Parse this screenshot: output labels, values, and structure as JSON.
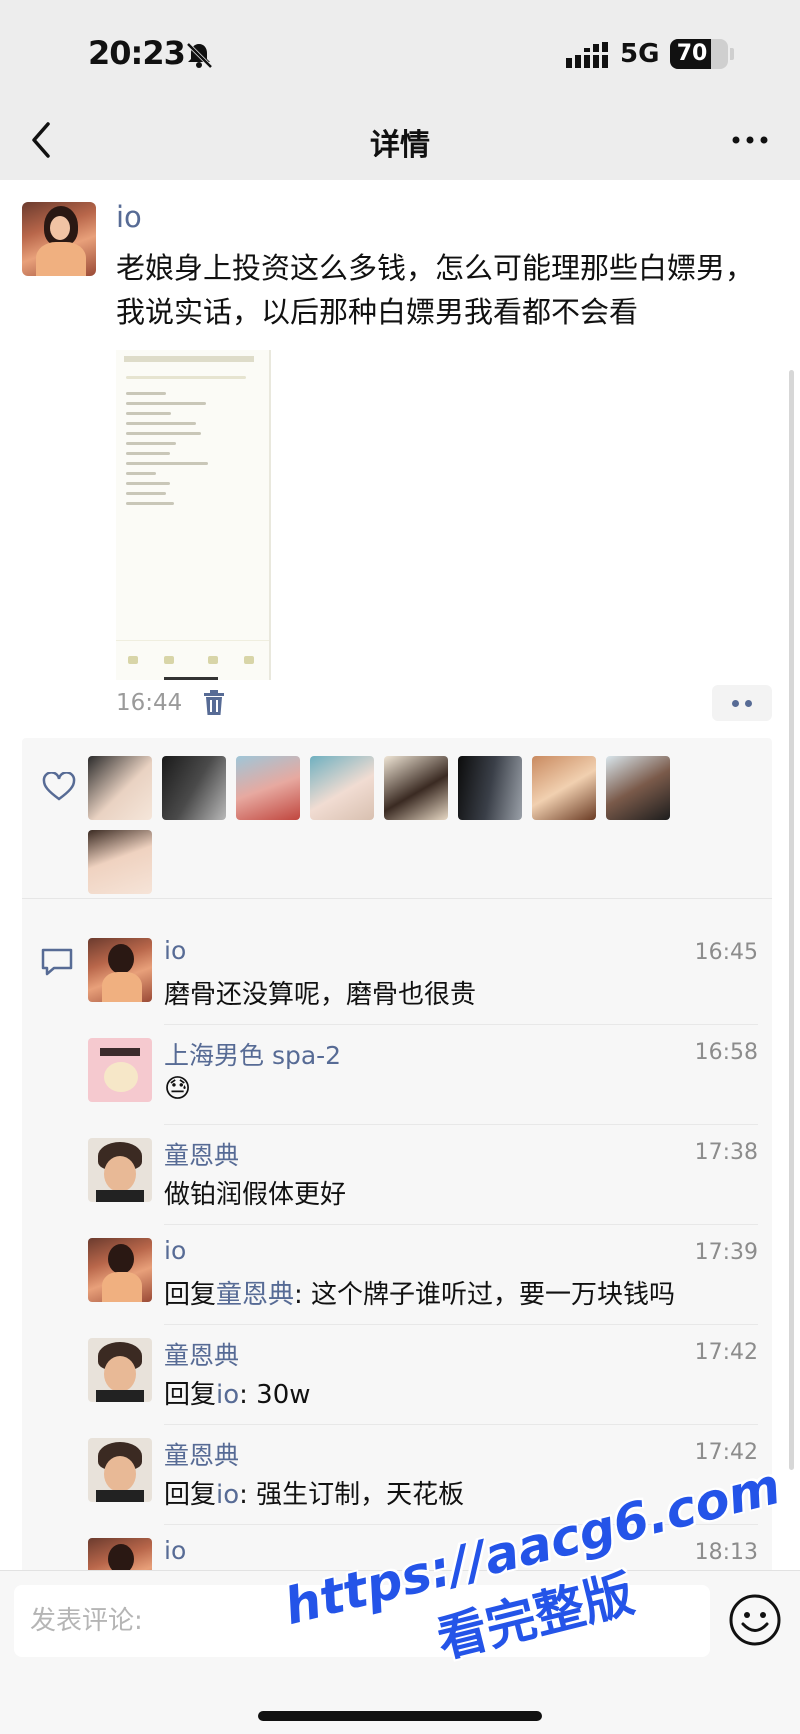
{
  "status_bar": {
    "time": "20:23",
    "network": "5G",
    "battery_level": "70",
    "battery_fraction": 0.7
  },
  "nav": {
    "title": "详情"
  },
  "post": {
    "author": "io",
    "text": "老娘身上投资这么多钱，怎么可能理那些白嫖男，我说实话，以后那种白嫖男我看都不会看",
    "time": "16:44"
  },
  "likes": {
    "count": 9
  },
  "comments": [
    {
      "name": "io",
      "time": "16:45",
      "text": "磨骨还没算呢，磨骨也很贵",
      "reply_to": "",
      "avatar": "io"
    },
    {
      "name": "上海男色 spa-2",
      "time": "16:58",
      "text": "😓",
      "reply_to": "",
      "avatar": "spa"
    },
    {
      "name": "童恩典",
      "time": "17:38",
      "text": "做铂润假体更好",
      "reply_to": "",
      "avatar": "tong"
    },
    {
      "name": "io",
      "time": "17:39",
      "text": ": 这个牌子谁听过，要一万块钱吗",
      "reply_word": "回复",
      "reply_to": "童恩典",
      "avatar": "io"
    },
    {
      "name": "童恩典",
      "time": "17:42",
      "text": ": 30w",
      "reply_word": "回复",
      "reply_to": "io",
      "avatar": "tong"
    },
    {
      "name": "童恩典",
      "time": "17:42",
      "text": ": 强生订制，天花板",
      "reply_word": "回复",
      "reply_to": "io",
      "avatar": "tong"
    },
    {
      "name": "io",
      "time": "18:13",
      "text": "",
      "reply_to": "",
      "avatar": "io"
    }
  ],
  "input": {
    "placeholder": "发表评论:"
  },
  "watermark": {
    "line1": "https://aacg6.com",
    "line2": "看完整版"
  },
  "colors": {
    "link": "#576b95",
    "watermark": "#2454e8"
  }
}
